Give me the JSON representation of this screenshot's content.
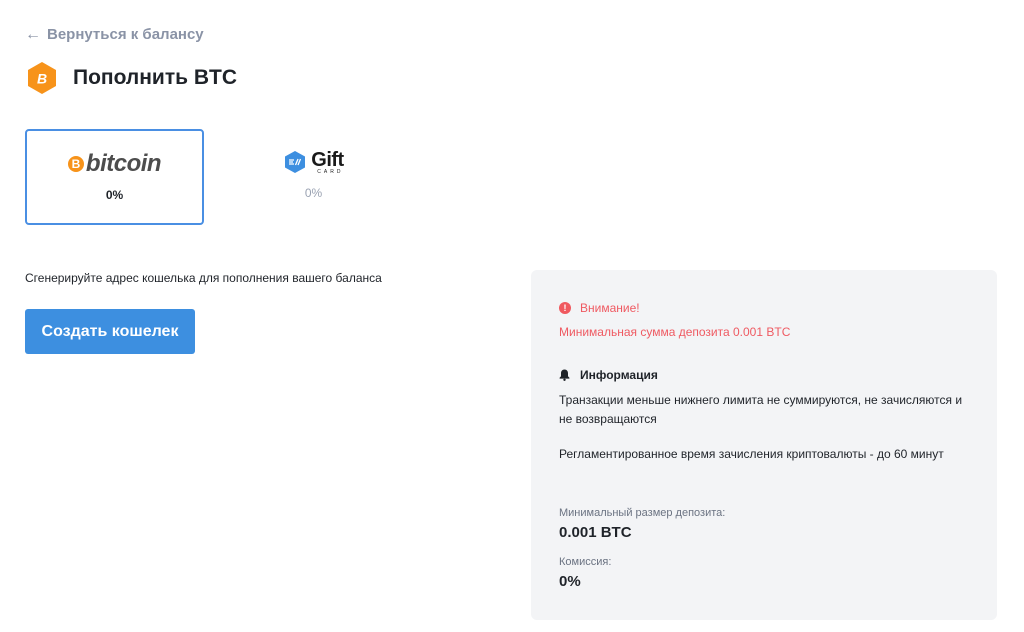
{
  "header": {
    "back_link": "Вернуться к балансу",
    "back_icon": "←",
    "title": "Пополнить BTC",
    "coin_symbol": "B",
    "coin_color": "#f7931a"
  },
  "methods": [
    {
      "name": "bitcoin",
      "logo_text": "bitcoin",
      "logo_symbol": "B",
      "percent": "0%",
      "selected": true
    },
    {
      "name": "gift-card",
      "logo_text": "Gift",
      "logo_sub": "CARD",
      "percent": "0%",
      "selected": false
    }
  ],
  "main": {
    "instruction": "Сгенерируйте адрес кошелька для пополнения вашего баланса",
    "create_button": "Создать кошелек"
  },
  "info_panel": {
    "warning_icon": "!",
    "warning_title": "Внимание!",
    "warning_text": "Минимальная сумма депозита 0.001 BTC",
    "info_title": "Информация",
    "info_text_1": "Транзакции меньше нижнего лимита не суммируются, не зачисляются и не возвращаются",
    "info_text_2": "Регламентированное время зачисления криптовалюты - до 60 минут",
    "min_deposit_label": "Минимальный размер депозита:",
    "min_deposit_value": "0.001 BTC",
    "fee_label": "Комиссия:",
    "fee_value": "0%"
  },
  "colors": {
    "accent": "#3d8fe0",
    "selected_border": "#4a8fe3",
    "warning": "#ef5a62",
    "panel_bg": "#f3f4f6",
    "muted": "#8a93a6"
  }
}
